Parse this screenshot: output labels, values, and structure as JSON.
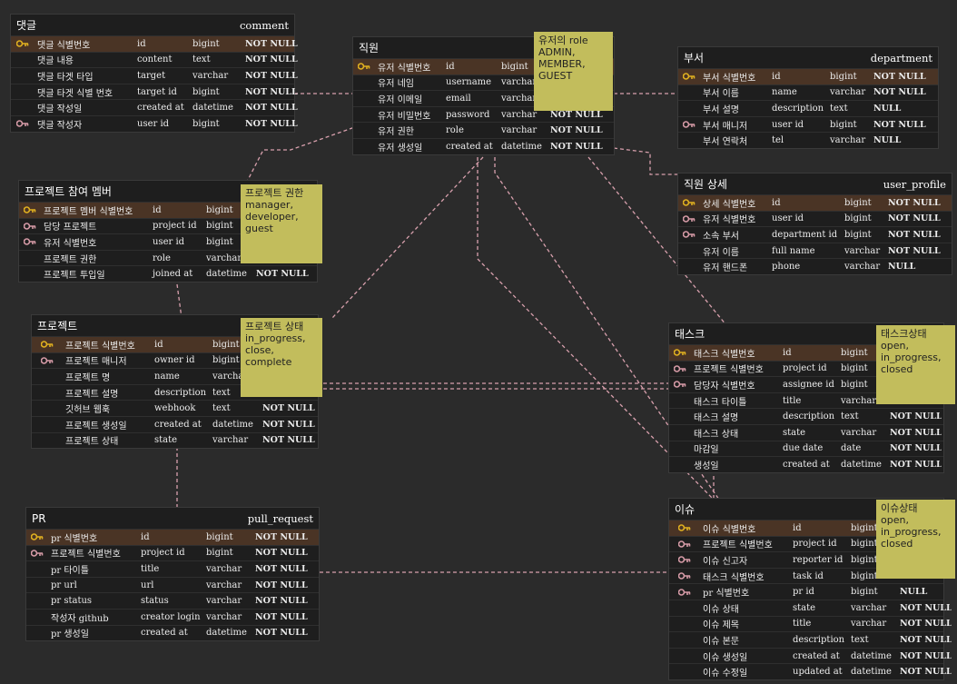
{
  "colors": {
    "background": "#2b2b2b",
    "table": "#1e1e1e",
    "pk_row": "#4a3425",
    "note": "#c2bd5c",
    "relation": "#d8a0ad",
    "key_pk": "#e0b020",
    "key_fk": "#d59aa6"
  },
  "tables": {
    "comment": {
      "title": "댓글",
      "name": "comment",
      "rows": [
        {
          "key": "pk",
          "label": "댓글 식별번호",
          "col": "id",
          "type": "bigint",
          "nn": "NOT NULL"
        },
        {
          "key": "",
          "label": "댓글 내용",
          "col": "content",
          "type": "text",
          "nn": "NOT NULL"
        },
        {
          "key": "",
          "label": "댓글 타겟 타입",
          "col": "target",
          "type": "varchar",
          "nn": "NOT NULL"
        },
        {
          "key": "",
          "label": "댓글 타겟 식별 번호",
          "col": "target id",
          "type": "bigint",
          "nn": "NOT NULL"
        },
        {
          "key": "",
          "label": "댓글 작성일",
          "col": "created at",
          "type": "datetime",
          "nn": "NOT NULL"
        },
        {
          "key": "fk",
          "label": "댓글 작성자",
          "col": "user id",
          "type": "bigint",
          "nn": "NOT NULL"
        }
      ]
    },
    "user": {
      "title": "직원",
      "name": "",
      "rows": [
        {
          "key": "pk",
          "label": "유저 식별번호",
          "col": "id",
          "type": "bigint",
          "nn": ""
        },
        {
          "key": "",
          "label": "유저 네임",
          "col": "username",
          "type": "varchar",
          "nn": ""
        },
        {
          "key": "",
          "label": "유저 이메일",
          "col": "email",
          "type": "varchar",
          "nn": ""
        },
        {
          "key": "",
          "label": "유저 비밀번호",
          "col": "password",
          "type": "varchar",
          "nn": "NOT NULL"
        },
        {
          "key": "",
          "label": "유저 권한",
          "col": "role",
          "type": "varchar",
          "nn": "NOT NULL"
        },
        {
          "key": "",
          "label": "유저 생성일",
          "col": "created at",
          "type": "datetime",
          "nn": "NOT NULL"
        }
      ]
    },
    "department": {
      "title": "부서",
      "name": "department",
      "rows": [
        {
          "key": "pk",
          "label": "부서 식별번호",
          "col": "id",
          "type": "bigint",
          "nn": "NOT NULL"
        },
        {
          "key": "",
          "label": "부서 이름",
          "col": "name",
          "type": "varchar",
          "nn": "NOT NULL"
        },
        {
          "key": "",
          "label": "부서 설명",
          "col": "description",
          "type": "text",
          "nn": "NULL"
        },
        {
          "key": "fk",
          "label": "부서 매니저",
          "col": "user id",
          "type": "bigint",
          "nn": "NOT NULL"
        },
        {
          "key": "",
          "label": "부서 연락처",
          "col": "tel",
          "type": "varchar",
          "nn": "NULL"
        }
      ]
    },
    "user_profile": {
      "title": "직원 상세",
      "name": "user_profile",
      "rows": [
        {
          "key": "pk",
          "label": "상세 식별번호",
          "col": "id",
          "type": "bigint",
          "nn": "NOT NULL"
        },
        {
          "key": "fk",
          "label": "유저 식별번호",
          "col": "user id",
          "type": "bigint",
          "nn": "NOT NULL"
        },
        {
          "key": "fk",
          "label": "소속 부서",
          "col": "department id",
          "type": "bigint",
          "nn": "NOT NULL"
        },
        {
          "key": "",
          "label": "유저 이름",
          "col": "full name",
          "type": "varchar",
          "nn": "NOT NULL"
        },
        {
          "key": "",
          "label": "유저 핸드폰",
          "col": "phone",
          "type": "varchar",
          "nn": "NULL"
        }
      ]
    },
    "project_member": {
      "title": "프로젝트 참여 멤버",
      "name": "",
      "rows": [
        {
          "key": "pk",
          "label": "프로젝트 멤버 식별번호",
          "col": "id",
          "type": "bigint",
          "nn": ""
        },
        {
          "key": "fk",
          "label": "담당 프로젝트",
          "col": "project id",
          "type": "bigint",
          "nn": ""
        },
        {
          "key": "fk",
          "label": "유저 식별번호",
          "col": "user id",
          "type": "bigint",
          "nn": ""
        },
        {
          "key": "",
          "label": "프로젝트 권한",
          "col": "role",
          "type": "varchar",
          "nn": ""
        },
        {
          "key": "",
          "label": "프로젝트 투입일",
          "col": "joined at",
          "type": "datetime",
          "nn": "NOT NULL"
        }
      ]
    },
    "project": {
      "title": "프로젝트",
      "name": "",
      "rows": [
        {
          "key": "pk",
          "label": "프로젝트 식별번호",
          "col": "id",
          "type": "bigint",
          "nn": ""
        },
        {
          "key": "fk",
          "label": "프로젝트 매니저",
          "col": "owner id",
          "type": "bigint",
          "nn": ""
        },
        {
          "key": "",
          "label": "프로젝트 명",
          "col": "name",
          "type": "varchar",
          "nn": ""
        },
        {
          "key": "",
          "label": "프로젝트 설명",
          "col": "description",
          "type": "text",
          "nn": ""
        },
        {
          "key": "",
          "label": "깃허브 웹훅",
          "col": "webhook",
          "type": "text",
          "nn": "NOT NULL"
        },
        {
          "key": "",
          "label": "프로젝트 생성일",
          "col": "created at",
          "type": "datetime",
          "nn": "NOT NULL"
        },
        {
          "key": "",
          "label": "프로젝트 상태",
          "col": "state",
          "type": "varchar",
          "nn": "NOT NULL"
        }
      ]
    },
    "task": {
      "title": "태스크",
      "name": "",
      "rows": [
        {
          "key": "pk",
          "label": "태스크 식별번호",
          "col": "id",
          "type": "bigint",
          "nn": ""
        },
        {
          "key": "fk",
          "label": "프로젝트 식별번호",
          "col": "project id",
          "type": "bigint",
          "nn": ""
        },
        {
          "key": "fk",
          "label": "담당자 식별번호",
          "col": "assignee id",
          "type": "bigint",
          "nn": ""
        },
        {
          "key": "",
          "label": "태스크 타이틀",
          "col": "title",
          "type": "varchar",
          "nn": ""
        },
        {
          "key": "",
          "label": "태스크 설명",
          "col": "description",
          "type": "text",
          "nn": "NOT NULL"
        },
        {
          "key": "",
          "label": "태스크 상태",
          "col": "state",
          "type": "varchar",
          "nn": "NOT NULL"
        },
        {
          "key": "",
          "label": "마감일",
          "col": "due date",
          "type": "date",
          "nn": "NOT NULL"
        },
        {
          "key": "",
          "label": "생성일",
          "col": "created at",
          "type": "datetime",
          "nn": "NOT NULL"
        }
      ]
    },
    "pull_request": {
      "title": "PR",
      "name": "pull_request",
      "rows": [
        {
          "key": "pk",
          "label": "pr 식별번호",
          "col": "id",
          "type": "bigint",
          "nn": "NOT NULL"
        },
        {
          "key": "fk",
          "label": "프로젝트 식별번호",
          "col": "project id",
          "type": "bigint",
          "nn": "NOT NULL"
        },
        {
          "key": "",
          "label": "pr 타이틀",
          "col": "title",
          "type": "varchar",
          "nn": "NOT NULL"
        },
        {
          "key": "",
          "label": "pr url",
          "col": "url",
          "type": "varchar",
          "nn": "NOT NULL"
        },
        {
          "key": "",
          "label": "pr status",
          "col": "status",
          "type": "varchar",
          "nn": "NOT NULL"
        },
        {
          "key": "",
          "label": "작성자 github",
          "col": "creator login",
          "type": "varchar",
          "nn": "NOT NULL"
        },
        {
          "key": "",
          "label": "pr 생성일",
          "col": "created at",
          "type": "datetime",
          "nn": "NOT NULL"
        }
      ]
    },
    "issue": {
      "title": "이슈",
      "name": "",
      "rows": [
        {
          "key": "pk",
          "label": "이슈 식별번호",
          "col": "id",
          "type": "bigint",
          "nn": ""
        },
        {
          "key": "fk",
          "label": "프로젝트 식별번호",
          "col": "project id",
          "type": "bigint",
          "nn": ""
        },
        {
          "key": "fk",
          "label": "이슈 신고자",
          "col": "reporter id",
          "type": "bigint",
          "nn": ""
        },
        {
          "key": "fk",
          "label": "태스크 식별번호",
          "col": "task id",
          "type": "bigint",
          "nn": ""
        },
        {
          "key": "fk",
          "label": "pr 식별번호",
          "col": "pr id",
          "type": "bigint",
          "nn": "NULL"
        },
        {
          "key": "",
          "label": "이슈 상태",
          "col": "state",
          "type": "varchar",
          "nn": "NOT NULL"
        },
        {
          "key": "",
          "label": "이슈 제목",
          "col": "title",
          "type": "varchar",
          "nn": "NOT NULL"
        },
        {
          "key": "",
          "label": "이슈 본문",
          "col": "description",
          "type": "text",
          "nn": "NOT NULL"
        },
        {
          "key": "",
          "label": "이슈 생성일",
          "col": "created at",
          "type": "datetime",
          "nn": "NOT NULL"
        },
        {
          "key": "",
          "label": "이슈 수정일",
          "col": "updated at",
          "type": "datetime",
          "nn": "NOT NULL"
        }
      ]
    }
  },
  "notes": {
    "user_role": "유저의 role\nADMIN,\nMEMBER,\nGUEST",
    "member_role": "프로젝트 권한\nmanager,\ndeveloper,\nguest",
    "project_state": "프로젝트 상태\nin_progress,\nclose,\ncomplete",
    "task_state": "태스크상태\nopen,\nin_progress,\nclosed",
    "issue_state": "이슈상태\nopen,\nin_progress,\nclosed"
  }
}
